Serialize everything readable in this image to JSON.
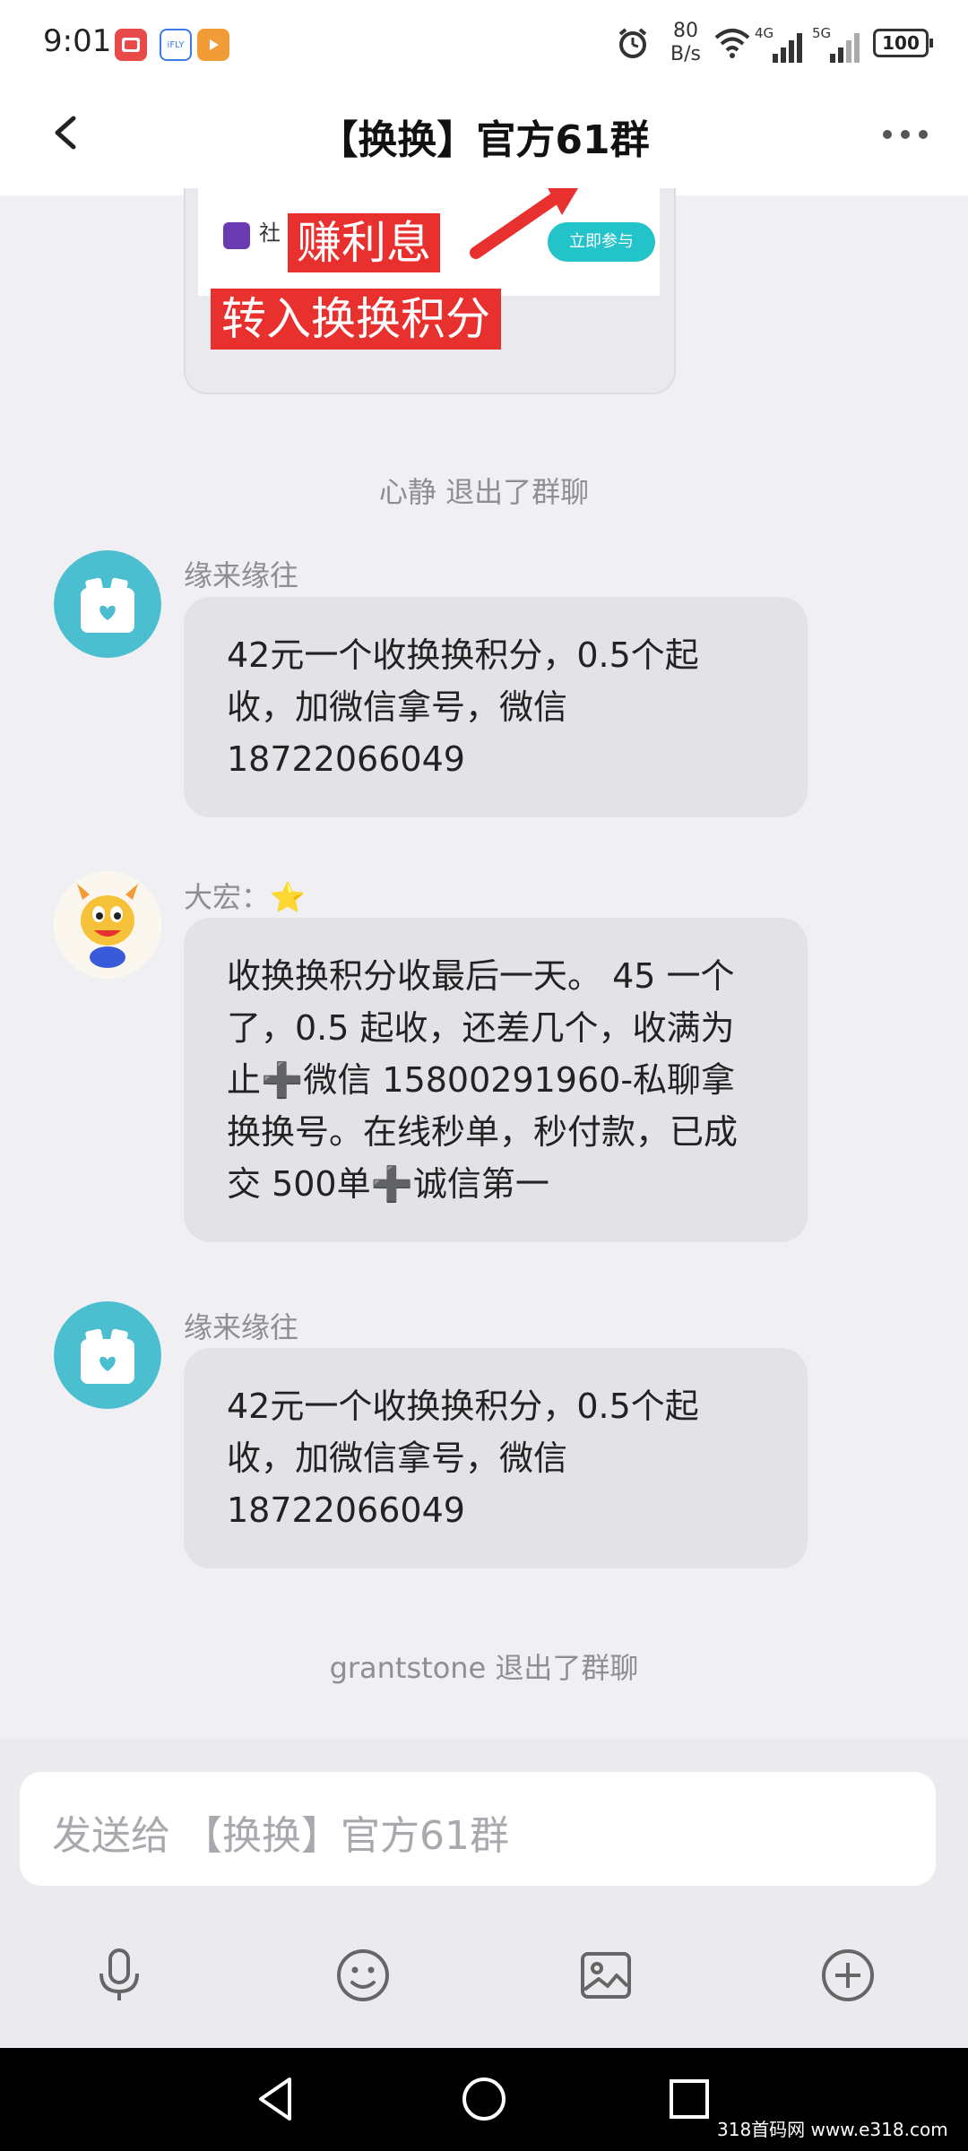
{
  "status_bar": {
    "time": "9:01",
    "net_speed_value": "80",
    "net_speed_unit": "B/s",
    "signal_1_label": "4G",
    "signal_2_label": "5G",
    "battery": "100",
    "app_icons": [
      "red-app-icon",
      "ifly-icon",
      "video-app-icon"
    ],
    "app_icon_text": [
      "",
      "iFLY",
      ""
    ]
  },
  "header": {
    "title": "【换换】官方61群"
  },
  "chat": {
    "image_card": {
      "banner_line1": "赚利息",
      "banner_line2": "转入换换积分",
      "button_label": "立即参与",
      "side_text": "社"
    },
    "system_1": "心静 退出了群聊",
    "messages": [
      {
        "sender": "缘来缘往",
        "text": "42元一个收换换积分，0.5个起收，加微信拿号，微信18722066049"
      },
      {
        "sender": "大宏：⭐",
        "text": "收换换积分收最后一天。 45 一个了，0.5 起收，还差几个，收满为止➕微信 15800291960-私聊拿换换号。在线秒单，秒付款，已成交 500单➕诚信第一"
      },
      {
        "sender": "缘来缘往",
        "text": "42元一个收换换积分，0.5个起收，加微信拿号，微信18722066049"
      }
    ],
    "system_2": "grantstone 退出了群聊"
  },
  "composer": {
    "placeholder": "发送给 【换换】官方61群"
  },
  "watermark": "318首码网 www.e318.com",
  "colors": {
    "background": "#efeff4",
    "bubble": "#e2e2e7",
    "avatar_teal": "#4bbfcf",
    "banner_red": "#e8312f",
    "button_teal": "#22c3c9"
  }
}
